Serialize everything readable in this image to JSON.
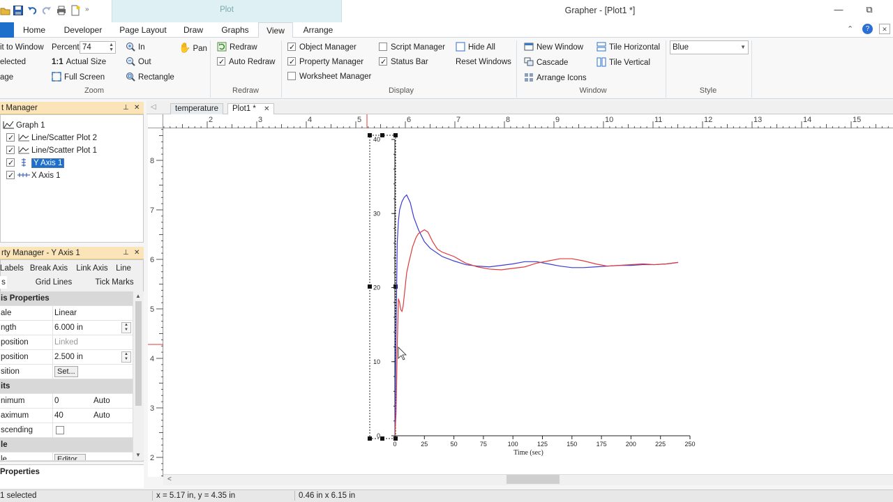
{
  "window": {
    "title": "Grapher - [Plot1 *]",
    "context_tab_label": "Plot",
    "min_glyph": "—",
    "restore_glyph": "⧉"
  },
  "ribbon_tabs": [
    "Home",
    "Developer",
    "Page Layout",
    "Draw",
    "Graphs",
    "View",
    "Arrange"
  ],
  "active_tab": "View",
  "ribbon": {
    "zoom": {
      "label": "Zoom",
      "fit_to_window": "it to Window",
      "selected": "elected",
      "page": "age",
      "percent_label": "Percent",
      "percent_value": "74",
      "actual_size": "Actual Size",
      "one_to_one": "1:1",
      "full_screen": "Full Screen",
      "in": "In",
      "out": "Out",
      "pan": "Pan",
      "rectangle": "Rectangle"
    },
    "redraw": {
      "label": "Redraw",
      "redraw": "Redraw",
      "auto_redraw": "Auto Redraw",
      "auto_redraw_checked": true
    },
    "display": {
      "label": "Display",
      "object_manager": "Object Manager",
      "property_manager": "Property Manager",
      "worksheet_manager": "Worksheet Manager",
      "script_manager": "Script Manager",
      "status_bar": "Status Bar",
      "hide_all": "Hide All",
      "reset_windows": "Reset Windows",
      "object_manager_checked": true,
      "property_manager_checked": true,
      "worksheet_manager_checked": false,
      "script_manager_checked": false,
      "status_bar_checked": true
    },
    "window": {
      "label": "Window",
      "new_window": "New Window",
      "cascade": "Cascade",
      "arrange_icons": "Arrange Icons",
      "tile_horizontal": "Tile Horizontal",
      "tile_vertical": "Tile Vertical"
    },
    "style": {
      "label": "Style",
      "value": "Blue"
    }
  },
  "object_manager": {
    "title": "t Manager",
    "items": [
      {
        "label": "Graph 1",
        "checked": false
      },
      {
        "label": "Line/Scatter Plot 2",
        "checked": true
      },
      {
        "label": "Line/Scatter Plot 1",
        "checked": true
      },
      {
        "label": "Y Axis 1",
        "checked": true
      },
      {
        "label": "X Axis 1",
        "checked": true
      }
    ]
  },
  "property_manager": {
    "title": "rty Manager - Y Axis 1",
    "tabs_row1": [
      "Labels",
      "Break Axis",
      "Link Axis",
      "Line"
    ],
    "tabs_row2": [
      "s",
      "Grid Lines",
      "Tick Marks"
    ],
    "rows": [
      {
        "type": "section",
        "key": "is Properties"
      },
      {
        "key": "ale",
        "value": "Linear"
      },
      {
        "key": "ngth",
        "value": "6.000 in",
        "spin": true
      },
      {
        "key": "position",
        "value": "Linked",
        "disabled": true
      },
      {
        "key": "position",
        "value": "2.500 in",
        "spin": true
      },
      {
        "key": "sition",
        "button": "Set..."
      },
      {
        "type": "section",
        "key": "its"
      },
      {
        "key": "nimum",
        "value": "0",
        "value2": "Auto"
      },
      {
        "key": "aximum",
        "value": "40",
        "value2": "Auto"
      },
      {
        "key": "scending",
        "checkbox": true
      },
      {
        "type": "section",
        "key": "le"
      },
      {
        "key": "le",
        "button": "Editor..."
      }
    ],
    "footer": "Properties"
  },
  "document_tabs": [
    "temperature",
    "Plot1 *"
  ],
  "ruler": {
    "h_labels": [
      "2",
      "3",
      "4",
      "5",
      "6",
      "7",
      "8",
      "9",
      "10",
      "11",
      "12",
      "13",
      "14",
      "15"
    ],
    "v_labels": [
      "8",
      "7",
      "6",
      "5",
      "4",
      "3",
      "2"
    ]
  },
  "chart_data": {
    "type": "line",
    "xlabel": "Time (sec)",
    "xlim": [
      0,
      250
    ],
    "ylim": [
      0,
      40
    ],
    "x_ticks": [
      0,
      25,
      50,
      75,
      100,
      125,
      150,
      175,
      200,
      225,
      250
    ],
    "y_ticks": [
      0,
      10,
      20,
      30,
      40
    ],
    "series": [
      {
        "color": "#3b3bd6",
        "x": [
          0,
          1,
          2,
          3,
          4,
          6,
          8,
          10,
          13,
          16,
          20,
          25,
          30,
          40,
          50,
          60,
          70,
          80,
          90,
          100,
          110,
          120,
          130,
          140,
          150,
          160,
          170,
          180,
          190,
          200,
          210,
          220,
          230,
          240
        ],
        "y": [
          0,
          14,
          26,
          29,
          30.5,
          31.6,
          32.2,
          32.5,
          31.5,
          29.5,
          27.8,
          26.2,
          25.3,
          24.2,
          23.6,
          23.1,
          22.9,
          22.8,
          23.0,
          23.2,
          23.5,
          23.5,
          23.2,
          22.9,
          22.7,
          22.7,
          22.8,
          22.9,
          23.0,
          23.0,
          23.1,
          23.1,
          23.2,
          23.4
        ]
      },
      {
        "color": "#e03a3a",
        "x": [
          0,
          1,
          2,
          3,
          4,
          5,
          6,
          7,
          8,
          10,
          12,
          15,
          18,
          20,
          25,
          28,
          32,
          36,
          40,
          50,
          60,
          70,
          80,
          90,
          100,
          110,
          120,
          130,
          140,
          150,
          160,
          170,
          180,
          190,
          200,
          210,
          220,
          230,
          240
        ],
        "y": [
          0,
          3,
          12,
          18.5,
          18,
          17,
          16.8,
          17.5,
          19,
          22,
          23.5,
          25.5,
          26.8,
          27.3,
          27.8,
          27.5,
          26.2,
          25.2,
          24.8,
          24.2,
          23.3,
          22.8,
          22.5,
          22.4,
          22.6,
          22.8,
          23.3,
          23.6,
          23.9,
          23.9,
          23.6,
          23.2,
          22.9,
          23.0,
          23.1,
          23.2,
          23.1,
          23.2,
          23.4
        ]
      }
    ]
  },
  "status": {
    "selection": "1 selected",
    "coords": "x = 5.17 in, y = 4.35 in",
    "size": "0.46 in x 6.15 in"
  }
}
